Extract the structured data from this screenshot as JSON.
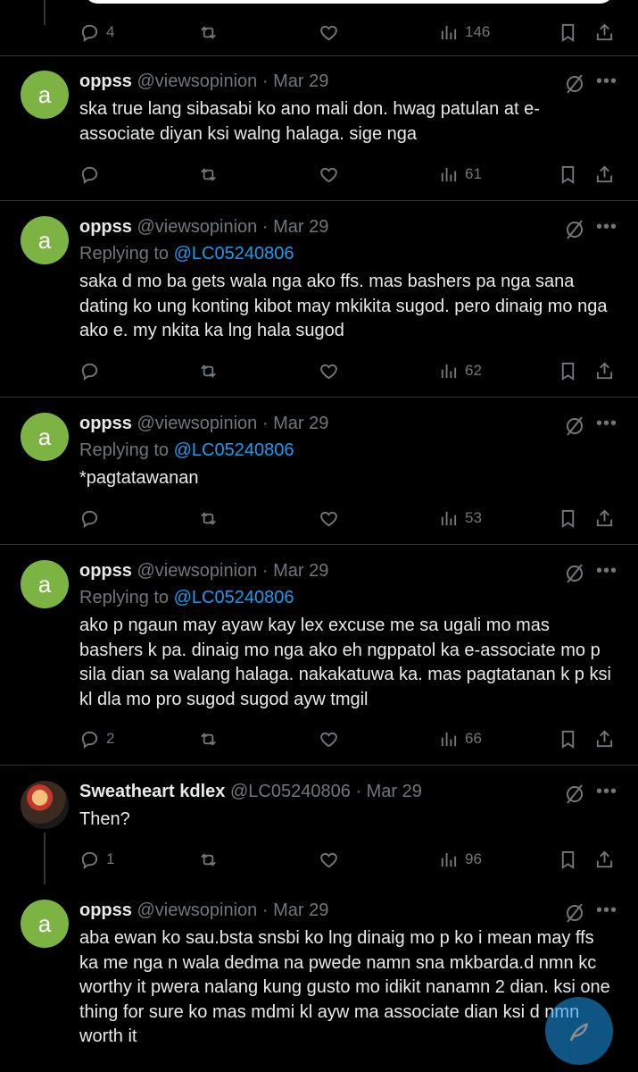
{
  "top_actions": {
    "replies": "4",
    "views": "146"
  },
  "tweets": [
    {
      "avatar": "a",
      "name": "oppss",
      "handle": "@viewsopinion",
      "date": "· Mar 29",
      "replying_to": "",
      "text": "ska true lang sibasabi ko ano mali don. hwag patulan at e-associate diyan ksi walng halaga. sige nga",
      "replies": "",
      "views": "61"
    },
    {
      "avatar": "a",
      "name": "oppss",
      "handle": "@viewsopinion",
      "date": "· Mar 29",
      "replying_to": "@LC05240806",
      "text": "saka d mo ba gets wala nga ako ffs. mas bashers pa nga sana dating ko ung konting kibot may mkikita sugod. pero dinaig mo nga ako e. my nkita ka lng hala sugod",
      "replies": "",
      "views": "62"
    },
    {
      "avatar": "a",
      "name": "oppss",
      "handle": "@viewsopinion",
      "date": "· Mar 29",
      "replying_to": "@LC05240806",
      "text": "*pagtatawanan",
      "replies": "",
      "views": "53"
    },
    {
      "avatar": "a",
      "name": "oppss",
      "handle": "@viewsopinion",
      "date": "· Mar 29",
      "replying_to": "@LC05240806",
      "text": "ako p ngaun may ayaw kay lex excuse me sa ugali mo mas bashers k pa. dinaig mo nga ako eh ngppatol ka e-associate mo p sila dian sa walang halaga. nakakatuwa ka. mas pagtatanan k p ksi kl dla mo pro sugod sugod ayw tmgil",
      "replies": "2",
      "views": "66"
    },
    {
      "avatar": "",
      "name": "Sweatheart kdlex",
      "handle": "@LC05240806",
      "date": "· Mar 29",
      "replying_to": "",
      "text": "Then?",
      "replies": "1",
      "views": "96"
    },
    {
      "avatar": "a",
      "name": "oppss",
      "handle": "@viewsopinion",
      "date": "· Mar 29",
      "replying_to": "",
      "text": "aba ewan ko sau.bsta snsbi ko lng dinaig mo p ko i mean may ffs ka me nga n wala dedma  na pwede namn sna mkbarda.d nmn kc worthy it pwera nalang kung gusto mo idikit nanamn 2 dian. ksi one thing for sure ko mas mdmi kl ayw ma associate dian ksi d nmn worth it",
      "replies": "",
      "views": ""
    }
  ],
  "replying_label": "Replying to",
  "colors": {
    "background": "#000000",
    "accent": "#1d9bf0",
    "avatar": "#7cb342",
    "muted": "#71767b"
  }
}
